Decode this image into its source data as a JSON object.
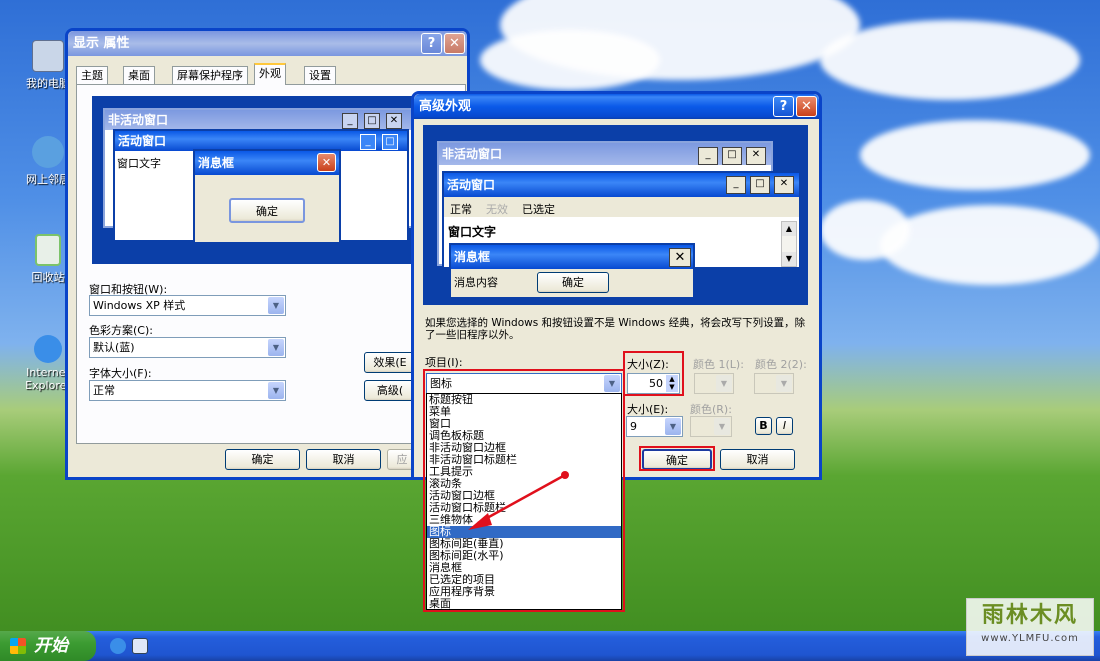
{
  "desktop": {
    "icons": [
      {
        "label": "我的电脑",
        "color": "#c9d6e8"
      },
      {
        "label": "网上邻居",
        "color": "#5aa0e0"
      },
      {
        "label": "回收站",
        "color": "#7cc36a"
      },
      {
        "label": "Internet Explorer",
        "color": "#3a8ee8"
      }
    ]
  },
  "display_props": {
    "title": "显示 属性",
    "help_btn": "?",
    "close_btn": "✕",
    "tabs": [
      "主题",
      "桌面",
      "屏幕保护程序",
      "外观",
      "设置"
    ],
    "preview": {
      "inactive_title": "非活动窗口",
      "active_title": "活动窗口",
      "window_text": "窗口文字",
      "msgbox_title": "消息框",
      "ok": "确定"
    },
    "windows_buttons_label": "窗口和按钮(W):",
    "windows_buttons_value": "Windows XP 样式",
    "color_scheme_label": "色彩方案(C):",
    "color_scheme_value": "默认(蓝)",
    "font_size_label": "字体大小(F):",
    "font_size_value": "正常",
    "effects_btn": "效果(E",
    "advanced_btn": "高级(",
    "ok_btn": "确定",
    "cancel_btn": "取消",
    "apply_btn": "应"
  },
  "advanced": {
    "title": "高级外观",
    "help_btn": "?",
    "close_btn": "✕",
    "preview": {
      "inactive_title": "非活动窗口",
      "active_title": "活动窗口",
      "menu_normal": "正常",
      "menu_disabled": "无效",
      "menu_selected": "已选定",
      "window_text": "窗口文字",
      "msgbox_title": "消息框",
      "msgbox_content": "消息内容",
      "ok": "确定"
    },
    "note": "如果您选择的 Windows 和按钮设置不是 Windows 经典，将会改写下列设置，除了一些旧程序以外。",
    "item_label": "项目(I):",
    "item_value": "图标",
    "size_label": "大小(Z):",
    "size_value": "50",
    "color1_label": "颜色 1(L):",
    "color2_label": "颜色 2(2):",
    "font_size_label": "大小(E):",
    "font_size_value": "9",
    "font_color_label": "颜色(R):",
    "bold_btn": "B",
    "italic_btn": "I",
    "ok_btn": "确定",
    "cancel_btn": "取消",
    "item_list": [
      "标题按钮",
      "菜单",
      "窗口",
      "调色板标题",
      "非活动窗口边框",
      "非活动窗口标题栏",
      "工具提示",
      "滚动条",
      "活动窗口边框",
      "活动窗口标题栏",
      "三维物体",
      "图标",
      "图标间距(垂直)",
      "图标间距(水平)",
      "消息框",
      "已选定的项目",
      "应用程序背景",
      "桌面"
    ],
    "selected_index": 11
  },
  "taskbar": {
    "start_label": "开始"
  },
  "watermark": {
    "text": "雨林木风",
    "url": "www.YLMFU.com"
  }
}
